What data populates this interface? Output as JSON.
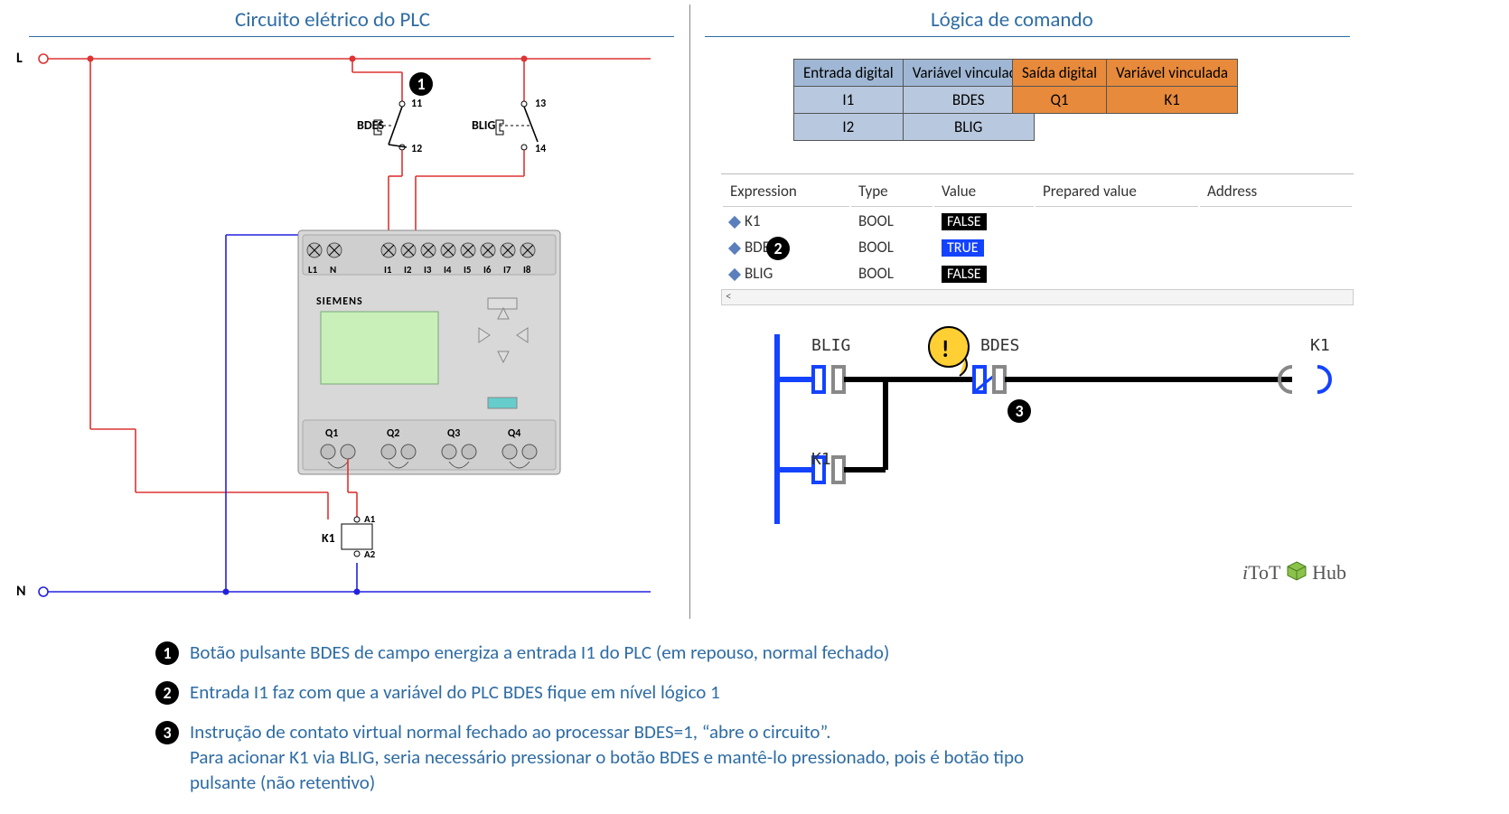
{
  "headers": {
    "left": "Circuito elétrico do PLC",
    "right": "Lógica de comando"
  },
  "rails": {
    "L": "L",
    "N": "N"
  },
  "buttons": {
    "bdes": {
      "name": "BDES",
      "t11": "11",
      "t12": "12"
    },
    "blig": {
      "name": "BLIG",
      "t13": "13",
      "t14": "14"
    }
  },
  "plc": {
    "brand": "SIEMENS",
    "inputs": [
      "L1",
      "N",
      "I1",
      "I2",
      "I3",
      "I4",
      "I5",
      "I6",
      "I7",
      "I8"
    ],
    "outputs": [
      "Q1",
      "Q2",
      "Q3",
      "Q4"
    ]
  },
  "relay": {
    "name": "K1",
    "a1": "A1",
    "a2": "A2"
  },
  "map_in": {
    "h1": "Entrada digital",
    "h2": "Variável vinculada",
    "rows": [
      [
        "I1",
        "BDES"
      ],
      [
        "I2",
        "BLIG"
      ]
    ]
  },
  "map_out": {
    "h1": "Saída digital",
    "h2": "Variável vinculada",
    "rows": [
      [
        "Q1",
        "K1"
      ]
    ]
  },
  "monitor": {
    "cols": {
      "expr": "Expression",
      "type": "Type",
      "val": "Value",
      "prep": "Prepared value",
      "addr": "Address"
    },
    "rows": [
      {
        "name": "K1",
        "type": "BOOL",
        "value": "FALSE",
        "state": "false"
      },
      {
        "name": "BDES",
        "type": "BOOL",
        "value": "TRUE",
        "state": "true"
      },
      {
        "name": "BLIG",
        "type": "BOOL",
        "value": "FALSE",
        "state": "false"
      }
    ]
  },
  "ladder": {
    "blig": "BLIG",
    "bdes": "BDES",
    "k1_out": "K1",
    "k1_seal": "K1",
    "warn": "!"
  },
  "brand": {
    "i": "i",
    "tot": "ToT",
    "hub": "Hub"
  },
  "bullets": {
    "b1": "1",
    "b2": "2",
    "b3": "3"
  },
  "explanations": {
    "e1": "Botão pulsante BDES de campo energiza a entrada I1 do PLC (em repouso, normal fechado)",
    "e2": "Entrada I1 faz com que a variável do PLC BDES fique em nível lógico 1",
    "e3a": "Instrução de contato virtual normal fechado ao processar BDES=1, “abre o circuito”.",
    "e3b": "Para acionar K1 via BLIG, seria necessário pressionar o botão BDES e mantê-lo pressionado, pois é botão tipo",
    "e3c": "pulsante (não retentivo)"
  },
  "scroll_hint": "<"
}
